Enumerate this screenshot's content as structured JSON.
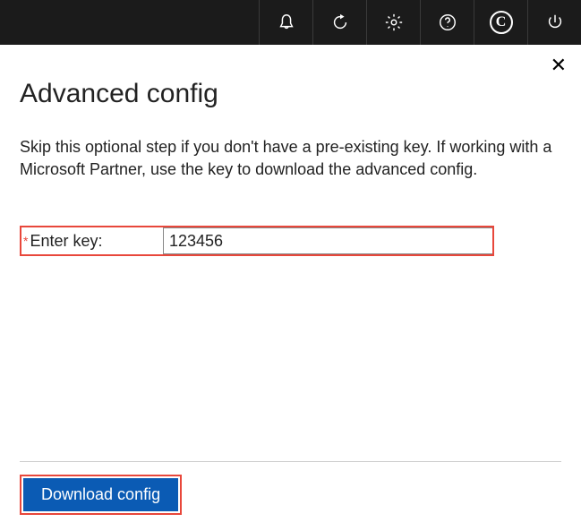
{
  "dialog": {
    "title": "Advanced config",
    "description": "Skip this optional step if you don't have a pre-existing key. If working with a Microsoft Partner, use the key to download the advanced config.",
    "field": {
      "required_mark": "*",
      "label": "Enter key:",
      "value": "123456"
    },
    "button": {
      "label": "Download config"
    }
  },
  "topbar": {
    "icons": [
      "bell",
      "refresh",
      "settings",
      "help",
      "copyright",
      "power"
    ]
  },
  "circle_letter": "C"
}
